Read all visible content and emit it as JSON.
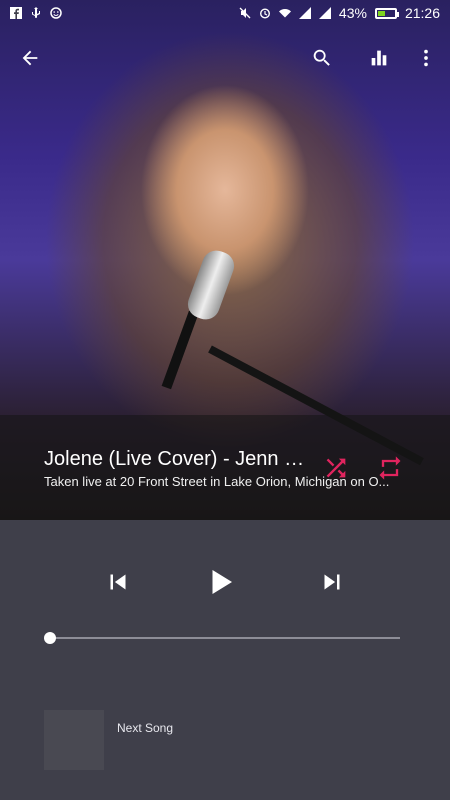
{
  "status_bar": {
    "battery_percent": "43%",
    "time": "21:26",
    "battery_level": 0.43,
    "battery_color": "#7ed321"
  },
  "toolbar": {
    "back_icon": "arrow-left-icon",
    "search_icon": "search-icon",
    "equalizer_icon": "equalizer-icon",
    "more_icon": "more-vertical-icon"
  },
  "track": {
    "title": "Jolene (Live Cover)  - Jenn Mc...",
    "subtitle": "Taken live at 20 Front Street in Lake Orion, Michigan on O...",
    "accent_color": "#e0245e"
  },
  "player": {
    "progress": 0.0,
    "prev_icon": "skip-previous-icon",
    "play_icon": "play-icon",
    "next_icon": "skip-next-icon"
  },
  "next_song": {
    "label": "Next Song"
  },
  "colors": {
    "background": "#3f3f4a"
  }
}
